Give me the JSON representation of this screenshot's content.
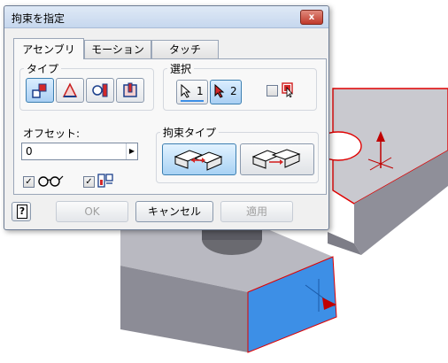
{
  "window": {
    "title": "拘束を指定",
    "close_label": "x"
  },
  "tabs": [
    {
      "label": "アセンブリ",
      "active": true
    },
    {
      "label": "モーション",
      "active": false
    },
    {
      "label": "タッチ",
      "active": false
    }
  ],
  "type_group": {
    "label": "タイプ",
    "buttons": [
      {
        "icon": "mate-constraint-icon",
        "selected": true
      },
      {
        "icon": "angle-constraint-icon",
        "selected": false
      },
      {
        "icon": "tangent-constraint-icon",
        "selected": false
      },
      {
        "icon": "insert-constraint-icon",
        "selected": false
      }
    ]
  },
  "selection_group": {
    "label": "選択",
    "select1_label": "1",
    "select2_label": "2",
    "pick_part_first_checked": false
  },
  "offset": {
    "label": "オフセット:",
    "value": "0"
  },
  "options": {
    "show_preview_checked": true,
    "predict_offset_checked": true,
    "check_mark": "✓"
  },
  "solution_group": {
    "label": "拘束タイプ",
    "mate_selected": true
  },
  "footer": {
    "help_label": "?",
    "ok_label": "OK",
    "cancel_label": "キャンセル",
    "apply_label": "適用"
  },
  "colors": {
    "highlight_blue": "#3d8fe6",
    "edge_red": "#e00000",
    "dialog_bg": "#f0f0f0"
  }
}
